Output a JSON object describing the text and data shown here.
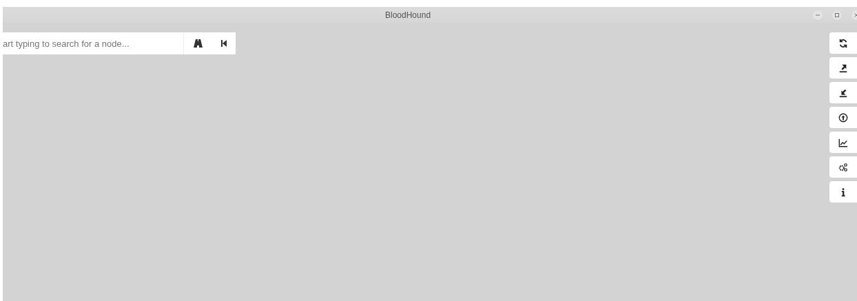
{
  "window": {
    "title": "BloodHound"
  },
  "search": {
    "placeholder": "art typing to search for a node..."
  }
}
